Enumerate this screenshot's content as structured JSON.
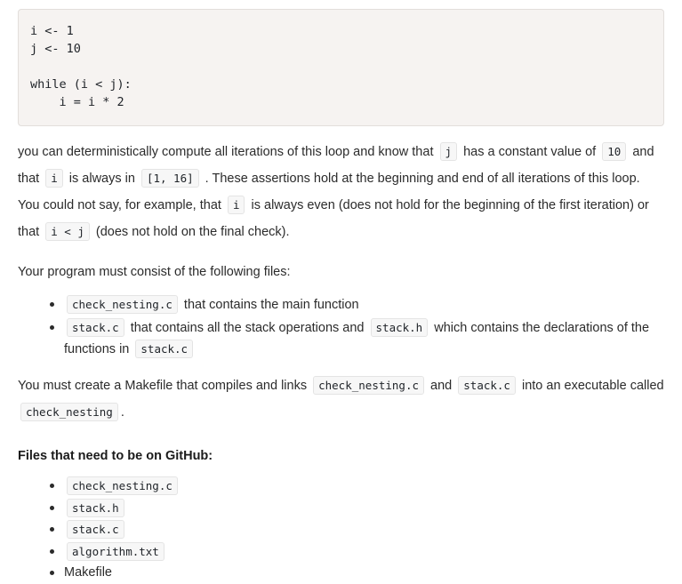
{
  "code_block": {
    "language": "pseudocode",
    "content": "i <- 1\nj <- 10\n\nwhile (i < j):\n    i = i * 2"
  },
  "paragraph1": {
    "t1": "you can deterministically compute all iterations of this loop and know that",
    "c1": "j",
    "t2": "has a constant value of",
    "c2": "10",
    "t3": "and that",
    "c3": "i",
    "t4": "is always in",
    "c4": "[1, 16]",
    "t5": ". These assertions hold at the beginning and end of all iterations of this loop. You could not say, for example, that",
    "c5": "i",
    "t6": "is always even (does not hold for the beginning of the first iteration) or that",
    "c6": "i < j",
    "t7": "(does not hold on the final check)."
  },
  "intro_files": "Your program must consist of the following files:",
  "required_files": {
    "item1": {
      "code": "check_nesting.c",
      "text": "that contains the main function"
    },
    "item2": {
      "code_a": "stack.c",
      "text_a": "that contains all the stack operations and",
      "code_b": "stack.h",
      "text_b": "which contains the declarations of the functions in",
      "code_c": "stack.c"
    }
  },
  "makefile_paragraph": {
    "t1": "You must create a Makefile that compiles and links",
    "c1": "check_nesting.c",
    "t2": "and",
    "c2": "stack.c",
    "t3": "into an executable called",
    "c3": "check_nesting",
    "t4": "."
  },
  "github_heading": "Files that need to be on GitHub:",
  "github_files": [
    {
      "label": "check_nesting.c",
      "is_code": true
    },
    {
      "label": "stack.h",
      "is_code": true
    },
    {
      "label": "stack.c",
      "is_code": true
    },
    {
      "label": "algorithm.txt",
      "is_code": true
    },
    {
      "label": "Makefile",
      "is_code": false
    }
  ],
  "colors": {
    "page_background": "#ffffff",
    "code_block_background": "#f6f3f1",
    "code_block_border": "#e2dedb",
    "inline_chip_background": "#f7f7f7",
    "inline_chip_border": "#e4e4e4",
    "text": "#2b2b2b"
  }
}
